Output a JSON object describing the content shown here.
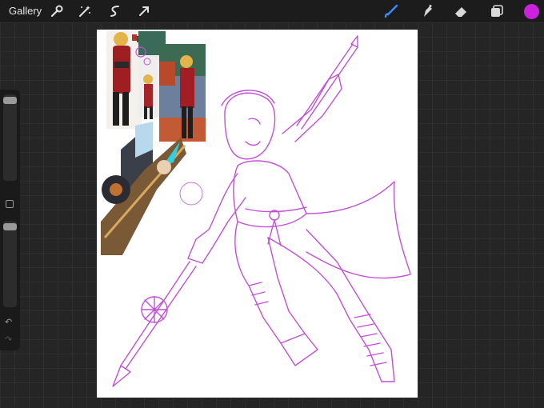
{
  "topbar": {
    "gallery_label": "Gallery",
    "left_tools": [
      "actions-wrench-icon",
      "adjustments-wand-icon",
      "selection-icon",
      "transform-arrow-icon"
    ],
    "right_tools": [
      "brush-icon",
      "smudge-icon",
      "eraser-icon",
      "layers-icon"
    ],
    "active_tool": "brush-icon",
    "current_color": "#cc22dd"
  },
  "sidebar": {
    "brush_size_level": 0.05,
    "opacity_level": 0.05,
    "controls": [
      "brush-size-slider",
      "modify-button",
      "opacity-slider",
      "undo-icon",
      "redo-icon"
    ]
  },
  "canvas": {
    "background": "#ffffff",
    "line_color": "#c24fd6",
    "references": [
      "character-reference-front",
      "character-reference-back",
      "character-reference-scene",
      "polearm-weapon-reference",
      "tassel-detail-reference"
    ]
  }
}
